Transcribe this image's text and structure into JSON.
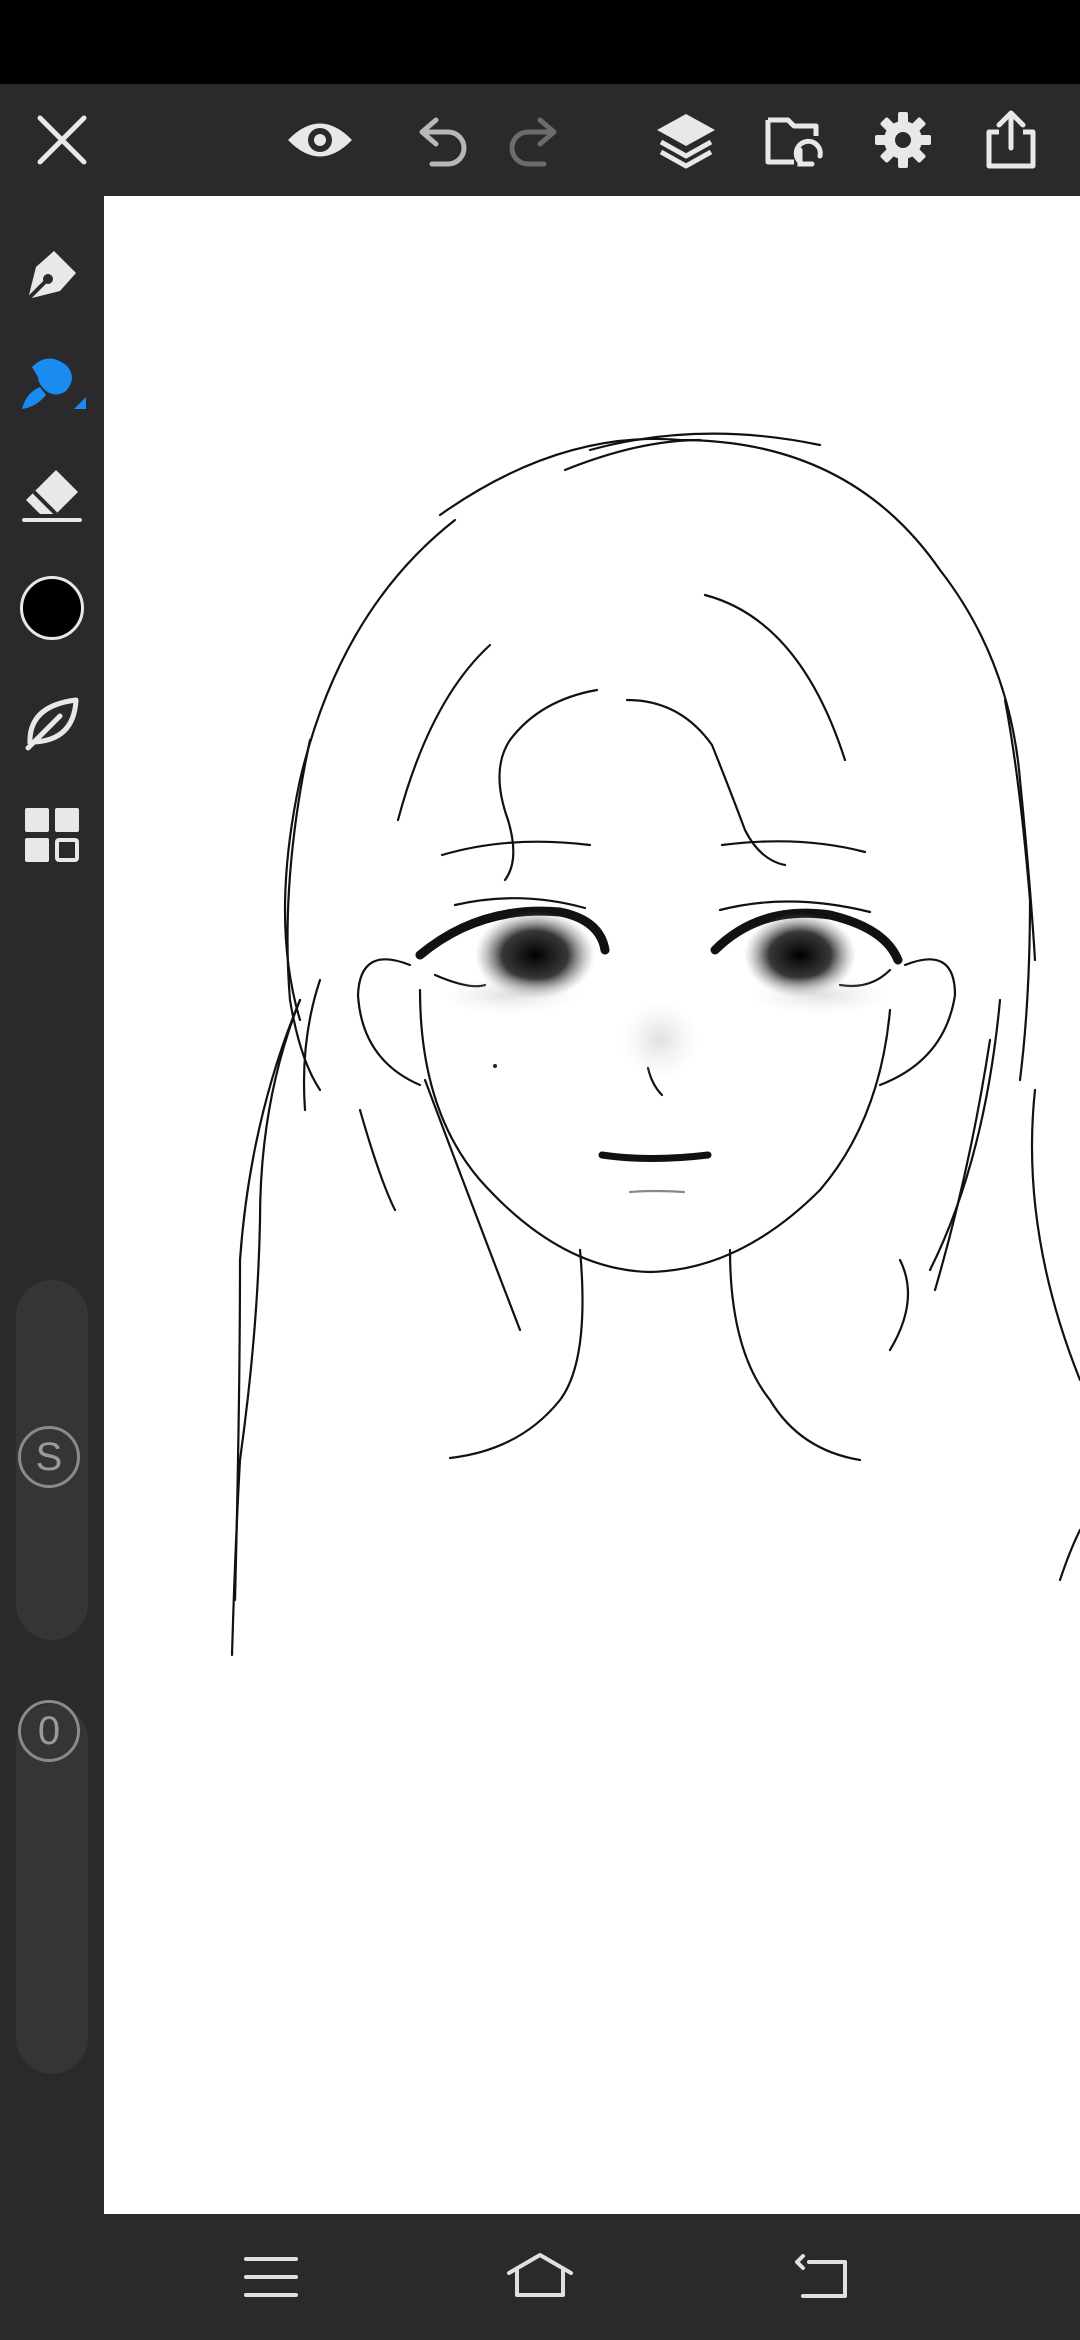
{
  "app": {
    "accent": "#1a8cf0",
    "toolbar_bg": "#2a2a2c",
    "canvas_bg": "#ffffff"
  },
  "top_toolbar": {
    "icons": [
      "close-icon",
      "eye-icon",
      "undo-icon",
      "redo-icon",
      "layers-icon",
      "import-image-icon",
      "gear-icon",
      "share-icon"
    ]
  },
  "left_toolbar": {
    "tools": [
      "pen-tool-icon",
      "brush-tool-icon",
      "eraser-tool-icon",
      "color-swatch",
      "material-leaf-icon",
      "grid-layout-icon"
    ],
    "active_tool": "brush",
    "current_color": "#000000",
    "size_slider_label": "S",
    "opacity_slider_label": "0"
  }
}
